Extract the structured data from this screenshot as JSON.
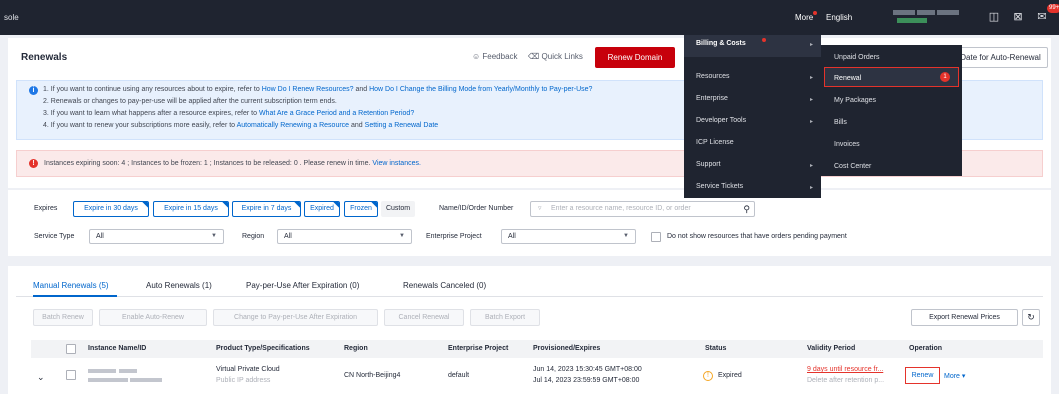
{
  "topbar": {
    "console": "sole",
    "more": "More",
    "language": "English",
    "badge": "99+"
  },
  "header": {
    "title": "Renewals",
    "feedback": "Feedback",
    "quick_links": "Quick Links",
    "renew_domain": "Renew Domain",
    "auto_renew_date": "Date for Auto-Renewal"
  },
  "info": {
    "line1_a": "1. If you want to continue using any resources about to expire, refer to ",
    "line1_link1": "How Do I Renew Resources?",
    "line1_b": " and ",
    "line1_link2": "How Do I Change the Billing Mode from Yearly/Monthly to Pay-per-Use?",
    "line2": "2. Renewals or changes to pay-per-use will be applied after the current subscription term ends.",
    "line3_a": "3. If you want to learn what happens after a resource expires, refer to ",
    "line3_link": "What Are a Grace Period and a Retention Period?",
    "line4_a": "4. If you want to renew your subscriptions more easily, refer to ",
    "line4_link1": "Automatically Renewing a Resource",
    "line4_b": " and ",
    "line4_link2": "Setting a Renewal Date"
  },
  "alert": {
    "text": "Instances expiring soon: 4 ; Instances to be frozen: 1 ; Instances to be released: 0 . Please renew in time.",
    "link": "View instances."
  },
  "filters": {
    "expires_label": "Expires",
    "chips": [
      "Expire in 30 days",
      "Expire in 15 days",
      "Expire in 7 days",
      "Expired",
      "Frozen",
      "Custom"
    ],
    "name_label": "Name/ID/Order Number",
    "search_placeholder": "Enter a resource name, resource ID, or order",
    "service_type_label": "Service Type",
    "service_type_value": "All",
    "region_label": "Region",
    "region_value": "All",
    "enterprise_label": "Enterprise Project",
    "enterprise_value": "All",
    "pending_checkbox": "Do not show resources that have orders pending payment"
  },
  "tabs": [
    {
      "label": "Manual Renewals (5)"
    },
    {
      "label": "Auto Renewals (1)"
    },
    {
      "label": "Pay-per-Use After Expiration (0)"
    },
    {
      "label": "Renewals Canceled (0)"
    }
  ],
  "actions": {
    "batch_renew": "Batch Renew",
    "enable_auto": "Enable Auto-Renew",
    "change_ppu": "Change to Pay-per-Use After Expiration",
    "cancel_renewal": "Cancel Renewal",
    "batch_export": "Batch Export",
    "export_prices": "Export Renewal Prices"
  },
  "table": {
    "headers": [
      "Instance Name/ID",
      "Product Type/Specifications",
      "Region",
      "Enterprise Project",
      "Provisioned/Expires",
      "Status",
      "Validity Period",
      "Operation"
    ],
    "row": {
      "product": "Virtual Private Cloud",
      "product_sub": "Public IP address",
      "region": "CN North-Beijing4",
      "enterprise": "default",
      "provisioned": "Jun 14, 2023 15:30:45 GMT+08:00",
      "expires": "Jul 14, 2023 23:59:59 GMT+08:00",
      "status": "Expired",
      "validity": "9 days until resource fr...",
      "validity_sub": "Delete after retention p...",
      "renew": "Renew",
      "more": "More"
    }
  },
  "menu": {
    "level1": [
      {
        "label": "Billing & Costs"
      },
      {
        "label": "Resources"
      },
      {
        "label": "Enterprise"
      },
      {
        "label": "Developer Tools"
      },
      {
        "label": "ICP License"
      },
      {
        "label": "Support"
      },
      {
        "label": "Service Tickets"
      }
    ],
    "level2": [
      {
        "label": "Unpaid Orders"
      },
      {
        "label": "Renewal"
      },
      {
        "label": "My Packages"
      },
      {
        "label": "Bills"
      },
      {
        "label": "Invoices"
      },
      {
        "label": "Cost Center"
      }
    ],
    "renewal_count": "1"
  },
  "colors": {
    "brand_red": "#c7000b",
    "link_blue": "#0066cc",
    "menu_bg": "#1f2430"
  }
}
